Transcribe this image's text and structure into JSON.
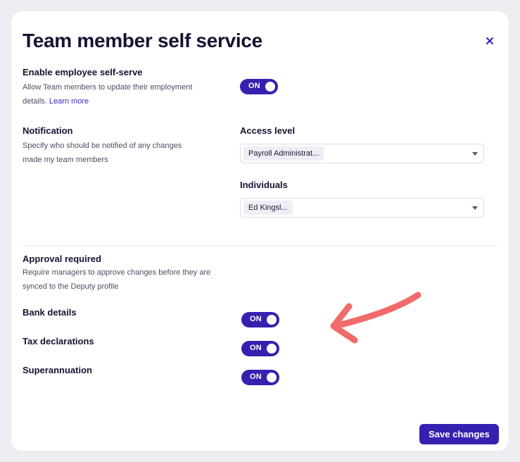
{
  "modal": {
    "title": "Team member self service",
    "close_icon": "close-icon"
  },
  "self_serve": {
    "heading": "Enable employee self-serve",
    "description": "Allow Team members to update their employment details.",
    "learn_more": "Learn more",
    "toggle_label": "ON",
    "enabled": true
  },
  "notification": {
    "heading": "Notification",
    "description": "Specify who should be notified of any changes made my team members",
    "access_level": {
      "label": "Access level",
      "selected": "Payroll Administrat..."
    },
    "individuals": {
      "label": "Individuals",
      "selected": "Ed Kingsl..."
    }
  },
  "approval": {
    "heading": "Approval required",
    "description": "Require managers to approve changes before they are synced to the Deputy profile",
    "items": [
      {
        "label": "Bank details",
        "toggle_label": "ON",
        "enabled": true
      },
      {
        "label": "Tax declarations",
        "toggle_label": "ON",
        "enabled": true
      },
      {
        "label": "Superannuation",
        "toggle_label": "ON",
        "enabled": true
      }
    ]
  },
  "footer": {
    "save_label": "Save changes"
  },
  "annotation": {
    "icon": "pointer-arrow-icon",
    "color": "#f26b6b"
  },
  "colors": {
    "accent": "#3521b0",
    "text": "#141332",
    "muted": "#4d4c63",
    "link": "#3a2bb8"
  }
}
